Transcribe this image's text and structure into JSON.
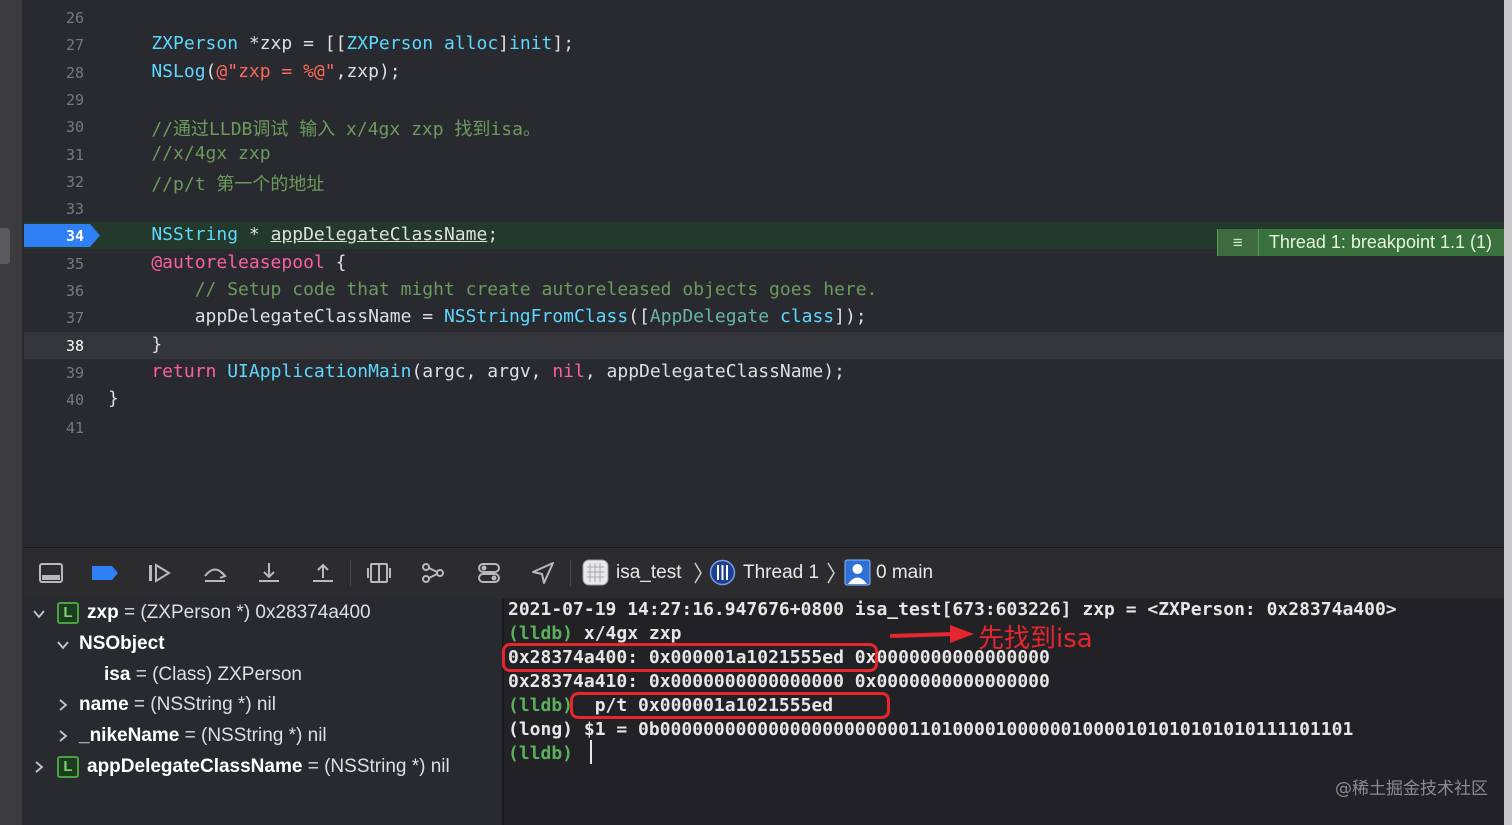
{
  "editor": {
    "lines": [
      {
        "n": "26",
        "segments": []
      },
      {
        "n": "27",
        "segments": [
          {
            "c": "c-type",
            "t": "    ZXPerson"
          },
          {
            "c": "c-plain",
            "t": " *zxp = [["
          },
          {
            "c": "c-type",
            "t": "ZXPerson"
          },
          {
            "c": "c-plain",
            "t": " "
          },
          {
            "c": "c-type",
            "t": "alloc"
          },
          {
            "c": "c-plain",
            "t": "]"
          },
          {
            "c": "c-type",
            "t": "init"
          },
          {
            "c": "c-plain",
            "t": "];"
          }
        ]
      },
      {
        "n": "28",
        "segments": [
          {
            "c": "c-type",
            "t": "    NSLog"
          },
          {
            "c": "c-plain",
            "t": "("
          },
          {
            "c": "c-str",
            "t": "@\"zxp = %@\""
          },
          {
            "c": "c-plain",
            "t": ",zxp);"
          }
        ]
      },
      {
        "n": "29",
        "segments": []
      },
      {
        "n": "30",
        "segments": [
          {
            "c": "c-cmt",
            "t": "    //通过LLDB调试 输入 x/4gx zxp 找到isa。"
          }
        ]
      },
      {
        "n": "31",
        "segments": [
          {
            "c": "c-cmt",
            "t": "    //x/4gx zxp"
          }
        ]
      },
      {
        "n": "32",
        "segments": [
          {
            "c": "c-cmt",
            "t": "    //p/t 第一个的地址"
          }
        ]
      },
      {
        "n": "33",
        "segments": []
      },
      {
        "n": "34",
        "segments": [
          {
            "c": "c-type",
            "t": "    NSString"
          },
          {
            "c": "c-plain",
            "t": " * "
          },
          {
            "c": "c-plain c-ul",
            "t": "appDelegateClassName"
          },
          {
            "c": "c-plain",
            "t": ";"
          }
        ]
      },
      {
        "n": "35",
        "segments": [
          {
            "c": "c-kw",
            "t": "    @autoreleasepool"
          },
          {
            "c": "c-plain",
            "t": " {"
          }
        ]
      },
      {
        "n": "36",
        "segments": [
          {
            "c": "c-cmt",
            "t": "        // Setup code that might create autoreleased objects goes here."
          }
        ]
      },
      {
        "n": "37",
        "segments": [
          {
            "c": "c-plain",
            "t": "        appDelegateClassName = "
          },
          {
            "c": "c-type",
            "t": "NSStringFromClass"
          },
          {
            "c": "c-plain",
            "t": "(["
          },
          {
            "c": "c-func",
            "t": "AppDelegate"
          },
          {
            "c": "c-plain",
            "t": " "
          },
          {
            "c": "c-type",
            "t": "class"
          },
          {
            "c": "c-plain",
            "t": "]);"
          }
        ]
      },
      {
        "n": "38",
        "segments": [
          {
            "c": "c-plain",
            "t": "    }"
          }
        ]
      },
      {
        "n": "39",
        "segments": [
          {
            "c": "c-kw",
            "t": "    return"
          },
          {
            "c": "c-plain",
            "t": " "
          },
          {
            "c": "c-type",
            "t": "UIApplicationMain"
          },
          {
            "c": "c-plain",
            "t": "(argc, argv, "
          },
          {
            "c": "c-kw",
            "t": "nil"
          },
          {
            "c": "c-plain",
            "t": ", appDelegateClassName);"
          }
        ]
      },
      {
        "n": "40",
        "segments": [
          {
            "c": "c-plain",
            "t": "}"
          }
        ]
      },
      {
        "n": "41",
        "segments": []
      }
    ],
    "breakpoint_line": "34",
    "current_line": "38",
    "breakpoint_label": "Thread 1: breakpoint 1.1 (1)"
  },
  "debug_bar": {
    "target": "isa_test",
    "thread": "Thread 1",
    "frame": "0 main"
  },
  "variables": {
    "zxp": {
      "name": "zxp",
      "value": "= (ZXPerson *) 0x28374a400",
      "badge": "L"
    },
    "nsobject": {
      "name": "NSObject"
    },
    "isa": {
      "name": "isa",
      "value": "= (Class) ZXPerson"
    },
    "name": {
      "name": "name",
      "value": "= (NSString *) nil"
    },
    "nike": {
      "name": "_nikeName",
      "value": "= (NSString *) nil"
    },
    "appdel": {
      "name": "appDelegateClassName",
      "value": "= (NSString *) nil",
      "badge": "L"
    }
  },
  "console": {
    "line1": "2021-07-19 14:27:16.947676+0800 isa_test[673:603226] zxp = <ZXPerson: 0x28374a400>",
    "line2_prompt": "(lldb)",
    "line2_cmd": " x/4gx zxp",
    "line3": "0x28374a400: 0x000001a1021555ed 0x0000000000000000",
    "line4": "0x28374a410: 0x0000000000000000 0x0000000000000000",
    "line5_prompt": "(lldb)",
    "line5_cmd": "  p/t 0x000001a1021555ed",
    "line6": "(long) $1 = 0b0000000000000000000000011010000100000010000101010101010111101101",
    "line7_prompt": "(lldb)",
    "annotation": "先找到isa",
    "watermark": "@稀土掘金技术社区"
  },
  "colors": {
    "accent_blue": "#2f7ff5",
    "breakpoint_green": "#38713c",
    "annotation_red": "#e5262d"
  }
}
